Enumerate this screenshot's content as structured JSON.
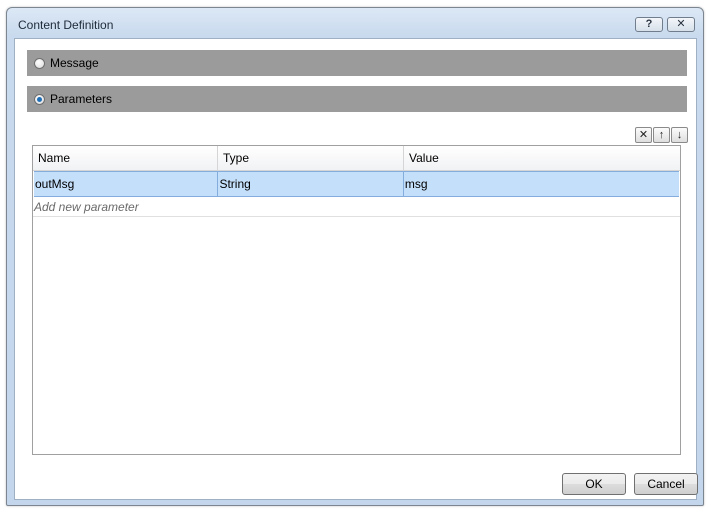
{
  "window": {
    "title": "Content Definition",
    "help_label": "?",
    "close_label": "✕"
  },
  "sections": {
    "message_label": "Message",
    "parameters_label": "Parameters",
    "selected": "Parameters"
  },
  "toolbar": {
    "delete_glyph": "✕",
    "up_glyph": "↑",
    "down_glyph": "↓"
  },
  "grid": {
    "columns": [
      "Name",
      "Type",
      "Value"
    ],
    "rows": [
      {
        "name": "outMsg",
        "type": "String",
        "value": "msg"
      }
    ],
    "add_new_label": "Add new parameter"
  },
  "buttons": {
    "ok_label": "OK",
    "cancel_label": "Cancel"
  },
  "colors": {
    "section_bar": "#9b9b9b",
    "selected_row": "#c4dffa",
    "selected_row_border": "#84acdd"
  }
}
